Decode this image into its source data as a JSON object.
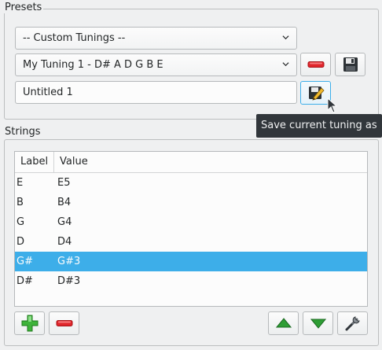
{
  "presets": {
    "title": "Presets",
    "category_combo": "-- Custom Tunings --",
    "tuning_combo": "My Tuning 1 - D# A D G B E",
    "name_value": "Untitled 1",
    "name_placeholder": ""
  },
  "tooltip": {
    "text": "Save current tuning as"
  },
  "strings": {
    "title": "Strings",
    "columns": [
      "Label",
      "Value"
    ],
    "rows": [
      {
        "label": "E",
        "value": "E5"
      },
      {
        "label": "B",
        "value": "B4"
      },
      {
        "label": "G",
        "value": "G4"
      },
      {
        "label": "D",
        "value": "D4"
      },
      {
        "label": "G#",
        "value": "G#3",
        "selected": true
      },
      {
        "label": "D#",
        "value": "D#3"
      }
    ]
  },
  "colors": {
    "accent": "#3daee9",
    "remove_red": "#e0262c",
    "add_green": "#3eb33a"
  },
  "icons": {
    "remove": "minus-icon",
    "save": "floppy-disk-icon",
    "save_as": "save-as-pencil-icon",
    "add": "plus-icon",
    "up": "arrow-up-icon",
    "down": "arrow-down-icon",
    "edit": "wrench-icon"
  }
}
